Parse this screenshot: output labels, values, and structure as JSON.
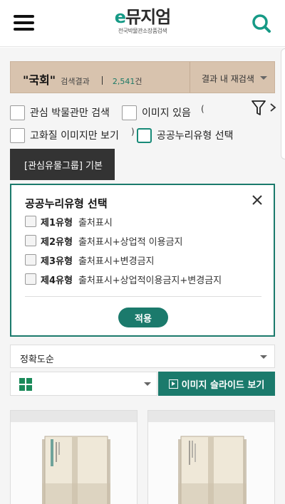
{
  "header": {
    "logo_e": "e",
    "logo_text": "뮤지엄",
    "logo_subtitle": "전국박물관소장품검색",
    "menu_icon": "hamburger-menu-icon",
    "search_icon": "search-icon"
  },
  "result_bar": {
    "query": "\"국회\"",
    "result_label": "검색결과",
    "count": "2,541",
    "count_unit": "건",
    "research_label": "결과 내 재검색"
  },
  "filters": {
    "interest_museum": "관심 박물관만 검색",
    "has_image": "이미지 있음",
    "hq_image": "고화질 이미지만 보기",
    "public_license": "공공누리유형 선택",
    "stray_paren_open": "(",
    "stray_paren_close": ")"
  },
  "group_button": "[관심유물그룹] 기본",
  "license_panel": {
    "title": "공공누리유형 선택",
    "options": [
      {
        "type": "제1유형",
        "desc": "출처표시"
      },
      {
        "type": "제2유형",
        "desc": "출처표시+상업적 이용금지"
      },
      {
        "type": "제3유형",
        "desc": "출처표시+변경금지"
      },
      {
        "type": "제4유형",
        "desc": "출처표시+상업적이용금지+변경금지"
      }
    ],
    "apply_label": "적용"
  },
  "sort": {
    "selected": "정확도순"
  },
  "view": {
    "selected_icon": "grid-view-icon",
    "slide_label": "이미지 슬라이드 보기"
  },
  "colors": {
    "brand": "#1b7a6c",
    "result_bar_bg": "#d8c3ae",
    "dark_button": "#333333"
  }
}
